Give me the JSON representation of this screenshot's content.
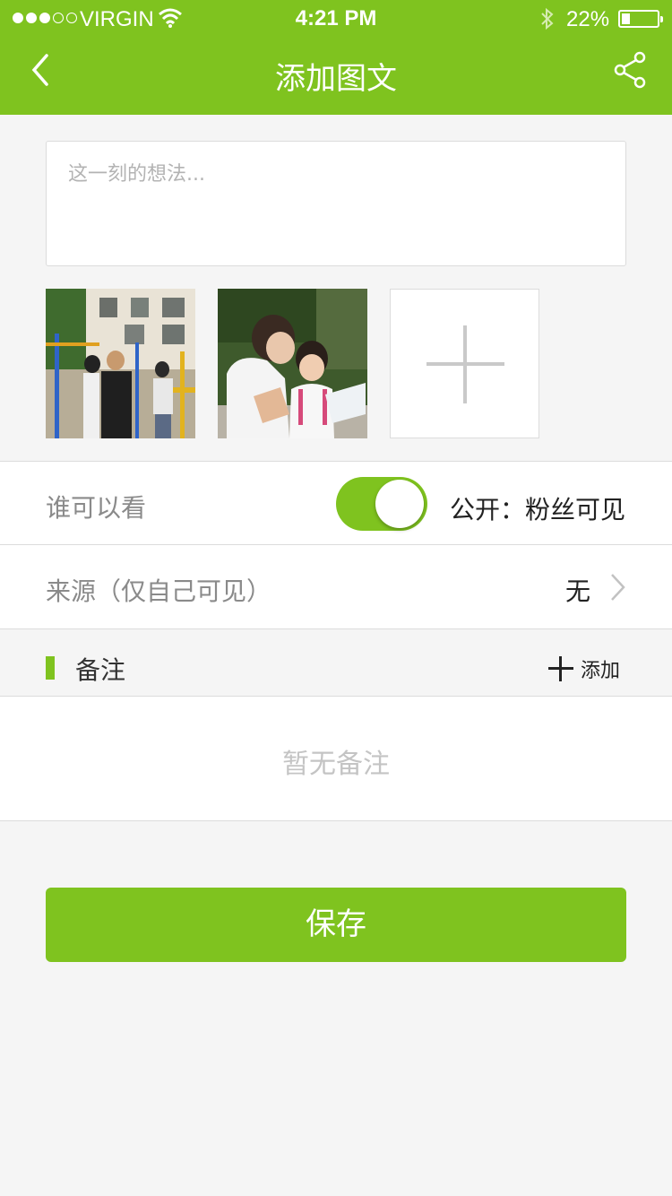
{
  "status_bar": {
    "carrier": "VIRGIN",
    "time": "4:21 PM",
    "battery": "22%",
    "signal_strength": 3,
    "battery_level": 0.22
  },
  "header": {
    "title": "添加图文",
    "back_icon": "chevron-left-icon",
    "share_icon": "share-icon"
  },
  "compose": {
    "placeholder": "这一刻的想法..."
  },
  "photos": {
    "items": [
      "photo-1",
      "photo-2"
    ],
    "add_icon": "plus-icon"
  },
  "visibility": {
    "label": "谁可以看",
    "enabled": true,
    "value": "公开：粉丝可见"
  },
  "source": {
    "label": "来源（仅自己可见）",
    "value": "无"
  },
  "notes": {
    "title": "备注",
    "add_label": "添加",
    "empty_text": "暂无备注"
  },
  "actions": {
    "save_label": "保存"
  },
  "colors": {
    "accent": "#7fc31f",
    "background": "#f5f5f5"
  }
}
